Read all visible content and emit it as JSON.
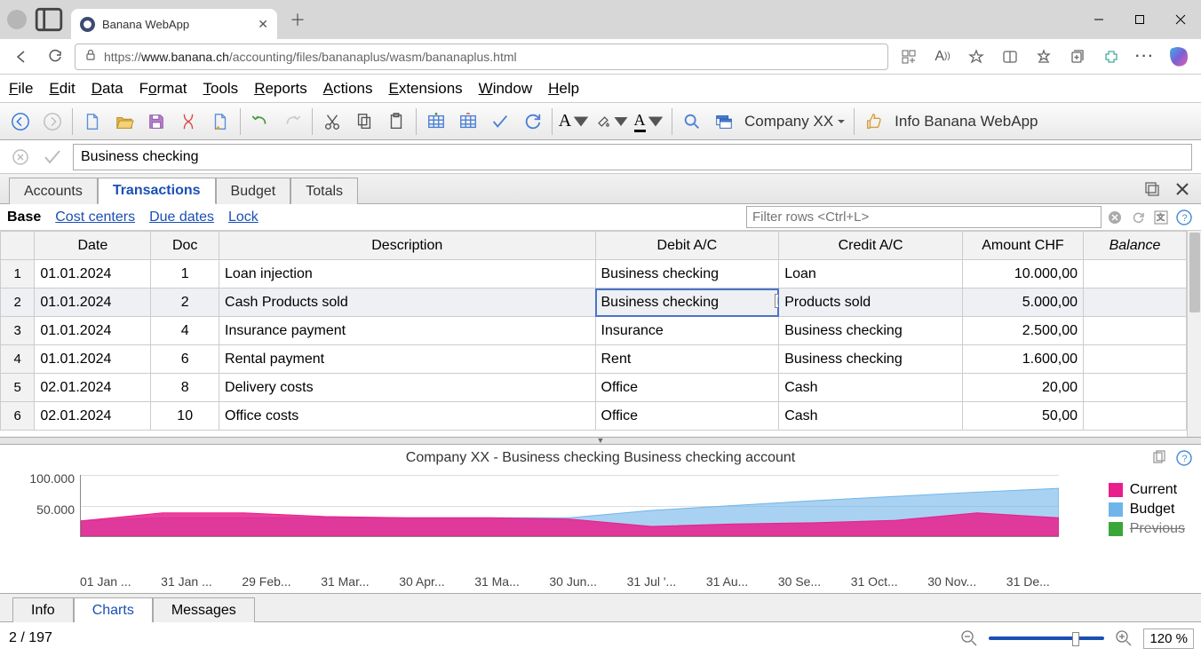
{
  "browser": {
    "tab_title": "Banana WebApp",
    "url_prefix": "https://",
    "url_host": "www.banana.ch",
    "url_path": "/accounting/files/bananaplus/wasm/bananaplus.html"
  },
  "menu": {
    "items": [
      "File",
      "Edit",
      "Data",
      "Format",
      "Tools",
      "Reports",
      "Actions",
      "Extensions",
      "Window",
      "Help"
    ]
  },
  "toolbar": {
    "company": "Company XX",
    "info": "Info Banana WebApp"
  },
  "cell_editor_value": "Business checking",
  "sheet_tabs": [
    "Accounts",
    "Transactions",
    "Budget",
    "Totals"
  ],
  "active_sheet_tab": "Transactions",
  "sub_tabs": {
    "base": "Base",
    "links": [
      "Cost centers",
      "Due dates",
      "Lock"
    ]
  },
  "filter_placeholder": "Filter rows <Ctrl+L>",
  "columns": [
    "Date",
    "Doc",
    "Description",
    "Debit A/C",
    "Credit A/C",
    "Amount CHF",
    "Balance"
  ],
  "rows": [
    {
      "n": "1",
      "date": "01.01.2024",
      "doc": "1",
      "desc": "Loan injection",
      "debit": "Business checking",
      "credit": "Loan",
      "amount": "10.000,00",
      "bal": ""
    },
    {
      "n": "2",
      "date": "01.01.2024",
      "doc": "2",
      "desc": "Cash Products sold",
      "debit": "Business checking",
      "credit": "Products sold",
      "amount": "5.000,00",
      "bal": ""
    },
    {
      "n": "3",
      "date": "01.01.2024",
      "doc": "4",
      "desc": "Insurance payment",
      "debit": "Insurance",
      "credit": "Business checking",
      "amount": "2.500,00",
      "bal": ""
    },
    {
      "n": "4",
      "date": "01.01.2024",
      "doc": "6",
      "desc": "Rental payment",
      "debit": "Rent",
      "credit": "Business checking",
      "amount": "1.600,00",
      "bal": ""
    },
    {
      "n": "5",
      "date": "02.01.2024",
      "doc": "8",
      "desc": "Delivery costs",
      "debit": "Office",
      "credit": "Cash",
      "amount": "20,00",
      "bal": ""
    },
    {
      "n": "6",
      "date": "02.01.2024",
      "doc": "10",
      "desc": "Office costs",
      "debit": "Office",
      "credit": "Cash",
      "amount": "50,00",
      "bal": ""
    }
  ],
  "selected_row": 1,
  "selected_col": "debit",
  "chart_data": {
    "type": "area",
    "title": "Company XX - Business checking Business checking account",
    "ylabel": "",
    "ylim": [
      0,
      100000
    ],
    "yticks": [
      "100.000",
      "50.000"
    ],
    "categories": [
      "01 Jan ...",
      "31 Jan ...",
      "29 Feb...",
      "31 Mar...",
      "30 Apr...",
      "31 Ma...",
      "30 Jun...",
      "31 Jul '...",
      "31 Au...",
      "30 Se...",
      "31 Oct...",
      "30 Nov...",
      "31 De..."
    ],
    "series": [
      {
        "name": "Current",
        "color": "#e91e8c",
        "values": [
          25000,
          38000,
          38000,
          32000,
          30000,
          30000,
          28000,
          16000,
          20000,
          22000,
          26000,
          38000,
          30000
        ]
      },
      {
        "name": "Budget",
        "color": "#6fb4ea",
        "values": [
          25000,
          30000,
          30000,
          30000,
          30000,
          30000,
          30000,
          42000,
          50000,
          58000,
          65000,
          72000,
          78000
        ]
      },
      {
        "name": "Previous",
        "color": "#3aa63a",
        "values": [],
        "disabled": true
      }
    ]
  },
  "bottom_tabs": [
    "Info",
    "Charts",
    "Messages"
  ],
  "active_bottom_tab": "Charts",
  "status": {
    "position": "2 / 197",
    "zoom": "120 %"
  }
}
